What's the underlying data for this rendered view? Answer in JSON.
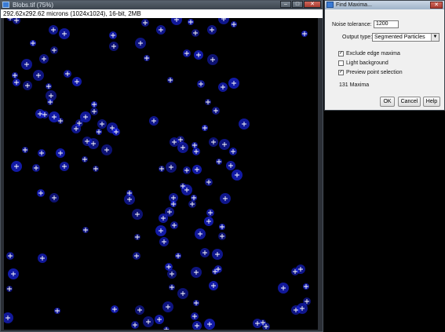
{
  "image_window": {
    "title": "Blobs.tif (75%)",
    "info": "292.62x292.62 microns (1024x1024), 16-bit, 2MB"
  },
  "dialog": {
    "title": "Find Maxima...",
    "noise_tolerance_label": "Noise tolerance:",
    "noise_tolerance_value": "1200",
    "output_type_label": "Output type:",
    "output_type_value": "Segmented Particles",
    "exclude_edge_label": "Exclude edge maxima",
    "exclude_edge_checked": true,
    "light_background_label": "Light background",
    "light_background_checked": false,
    "preview_label": "Preview point selection",
    "preview_checked": true,
    "maxima_count": "131 Maxima",
    "ok_label": "OK",
    "cancel_label": "Cancel",
    "help_label": "Help"
  },
  "colors": {
    "canvas": "#000000",
    "blob": "#1c28ff",
    "marker": "#ffffff"
  }
}
